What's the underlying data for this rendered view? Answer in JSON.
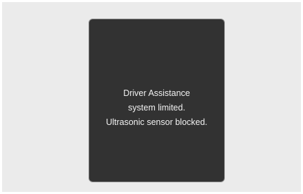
{
  "message": {
    "lines": [
      "Driver Assistance",
      "system limited.",
      "Ultrasonic sensor blocked."
    ]
  },
  "colors": {
    "background": "#ebebeb",
    "panel": "#323232",
    "panel_border": "#8a8a8a",
    "text": "#f2f2f2"
  }
}
